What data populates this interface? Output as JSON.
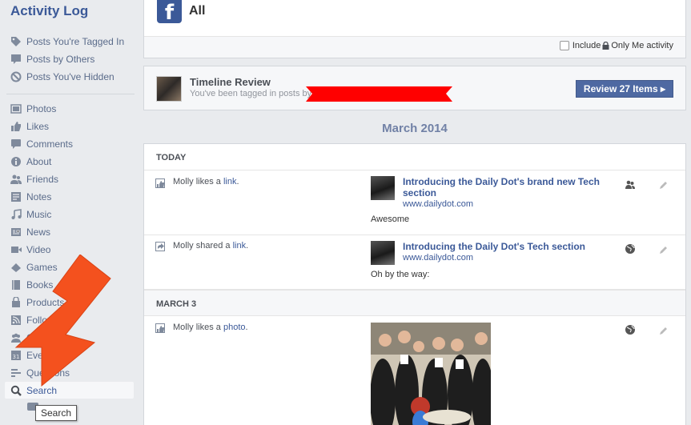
{
  "sidebar": {
    "title": "Activity Log",
    "filters": [
      {
        "label": "Posts You're Tagged In",
        "icon": "tag-icon"
      },
      {
        "label": "Posts by Others",
        "icon": "comment-box-icon"
      },
      {
        "label": "Posts You've Hidden",
        "icon": "hidden-circle-icon"
      }
    ],
    "items": [
      {
        "label": "Photos",
        "icon": "photos-icon"
      },
      {
        "label": "Likes",
        "icon": "thumbs-up-icon"
      },
      {
        "label": "Comments",
        "icon": "comment-icon"
      },
      {
        "label": "About",
        "icon": "info-icon"
      },
      {
        "label": "Friends",
        "icon": "friends-icon"
      },
      {
        "label": "Notes",
        "icon": "notes-icon"
      },
      {
        "label": "Music",
        "icon": "music-icon"
      },
      {
        "label": "News",
        "icon": "news-icon"
      },
      {
        "label": "Video",
        "icon": "video-icon"
      },
      {
        "label": "Games",
        "icon": "games-icon"
      },
      {
        "label": "Books",
        "icon": "books-icon"
      },
      {
        "label": "Products",
        "icon": "products-icon"
      },
      {
        "label": "Following",
        "icon": "following-icon"
      },
      {
        "label": "Groups",
        "icon": "groups-icon"
      },
      {
        "label": "Events",
        "icon": "events-icon"
      },
      {
        "label": "Questions",
        "icon": "questions-icon"
      },
      {
        "label": "Search",
        "icon": "search-icon",
        "selected": true
      }
    ],
    "events_day": "31"
  },
  "header": {
    "logo_letter": "f",
    "title": "All",
    "include_label": "Include",
    "only_me_label": "Only Me activity",
    "include_checked": false
  },
  "review": {
    "title": "Timeline Review",
    "subtitle": "You've been tagged in posts by",
    "button_label": "Review 27 Items ▸"
  },
  "month": "March 2014",
  "feed": {
    "days": [
      {
        "label": "TODAY",
        "entries": [
          {
            "actor": "Molly",
            "verb": "likes a",
            "object": "link",
            "end": ".",
            "action_icon": "like-link-icon",
            "link_title": "Introducing the Daily Dot's brand new Tech section",
            "domain": "www.dailydot.com",
            "comment": "Awesome",
            "audience_icon": "friends-audience-icon",
            "edit_icon": "pencil-icon"
          },
          {
            "actor": "Molly",
            "verb": "shared a",
            "object": "link",
            "end": ".",
            "action_icon": "share-link-icon",
            "link_title": "Introducing the Daily Dot's Tech section",
            "domain": "www.dailydot.com",
            "comment": "Oh by the way:",
            "audience_icon": "globe-icon",
            "edit_icon": "pencil-icon"
          }
        ]
      },
      {
        "label": "MARCH 3",
        "entries": [
          {
            "actor": "Molly",
            "verb": "likes a",
            "object": "photo",
            "end": ".",
            "action_icon": "like-photo-icon",
            "audience_icon": "globe-icon",
            "edit_icon": "pencil-icon"
          }
        ]
      }
    ]
  },
  "tooltip": "Search",
  "colors": {
    "brand": "#3b5998",
    "button": "#4e69a2",
    "redaction": "#ff0000",
    "annotation_arrow": "#f4511e"
  }
}
